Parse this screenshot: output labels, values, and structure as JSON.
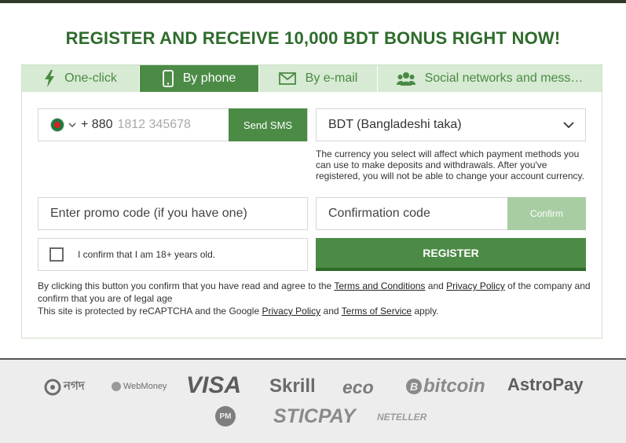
{
  "headline": "REGISTER AND RECEIVE 10,000 BDT BONUS RIGHT NOW!",
  "tabs": [
    {
      "label": "One-click",
      "icon": "lightning-icon"
    },
    {
      "label": "By phone",
      "icon": "phone-icon",
      "active": true
    },
    {
      "label": "By e-mail",
      "icon": "envelope-icon"
    },
    {
      "label": "Social networks and mess…",
      "icon": "users-icon"
    }
  ],
  "phone": {
    "country_code": "+ 880",
    "placeholder": "1812 345678",
    "send_sms_label": "Send SMS"
  },
  "currency": {
    "selected": "BDT (Bangladeshi taka)",
    "note": "The currency you select will affect which payment methods you can use to make deposits and withdrawals. After you've registered, you will not be able to change your account currency."
  },
  "promo": {
    "placeholder": "Enter promo code (if you have one)"
  },
  "confirmation": {
    "placeholder": "Confirmation code",
    "button_label": "Confirm"
  },
  "age_confirm_label": "I confirm that I am 18+ years old.",
  "register_label": "REGISTER",
  "legal": {
    "prefix": "By clicking this button you confirm that you have read and agree to the",
    "terms_link": "Terms and Conditions",
    "and": "and",
    "privacy_link": "Privacy Policy",
    "suffix": "of the company and confirm that you are of legal age",
    "recaptcha_prefix": "This site is protected by reCAPTCHA and the Google",
    "google_privacy_link": "Privacy Policy",
    "recaptcha_and": "and",
    "terms_of_service_link": "Terms of Service",
    "recaptcha_suffix": "apply."
  },
  "payment_methods": [
    "নগদ",
    "WebMoney",
    "VISA",
    "Skrill",
    "eco",
    "bitcoin",
    "AstroPay",
    "PM",
    "STICPAY",
    "NETELLER"
  ],
  "colors": {
    "brand_green": "#4c8b46",
    "heading_green": "#2e6b2b",
    "tab_bg": "#d7ead3",
    "confirm_disabled": "#a8cda3"
  }
}
